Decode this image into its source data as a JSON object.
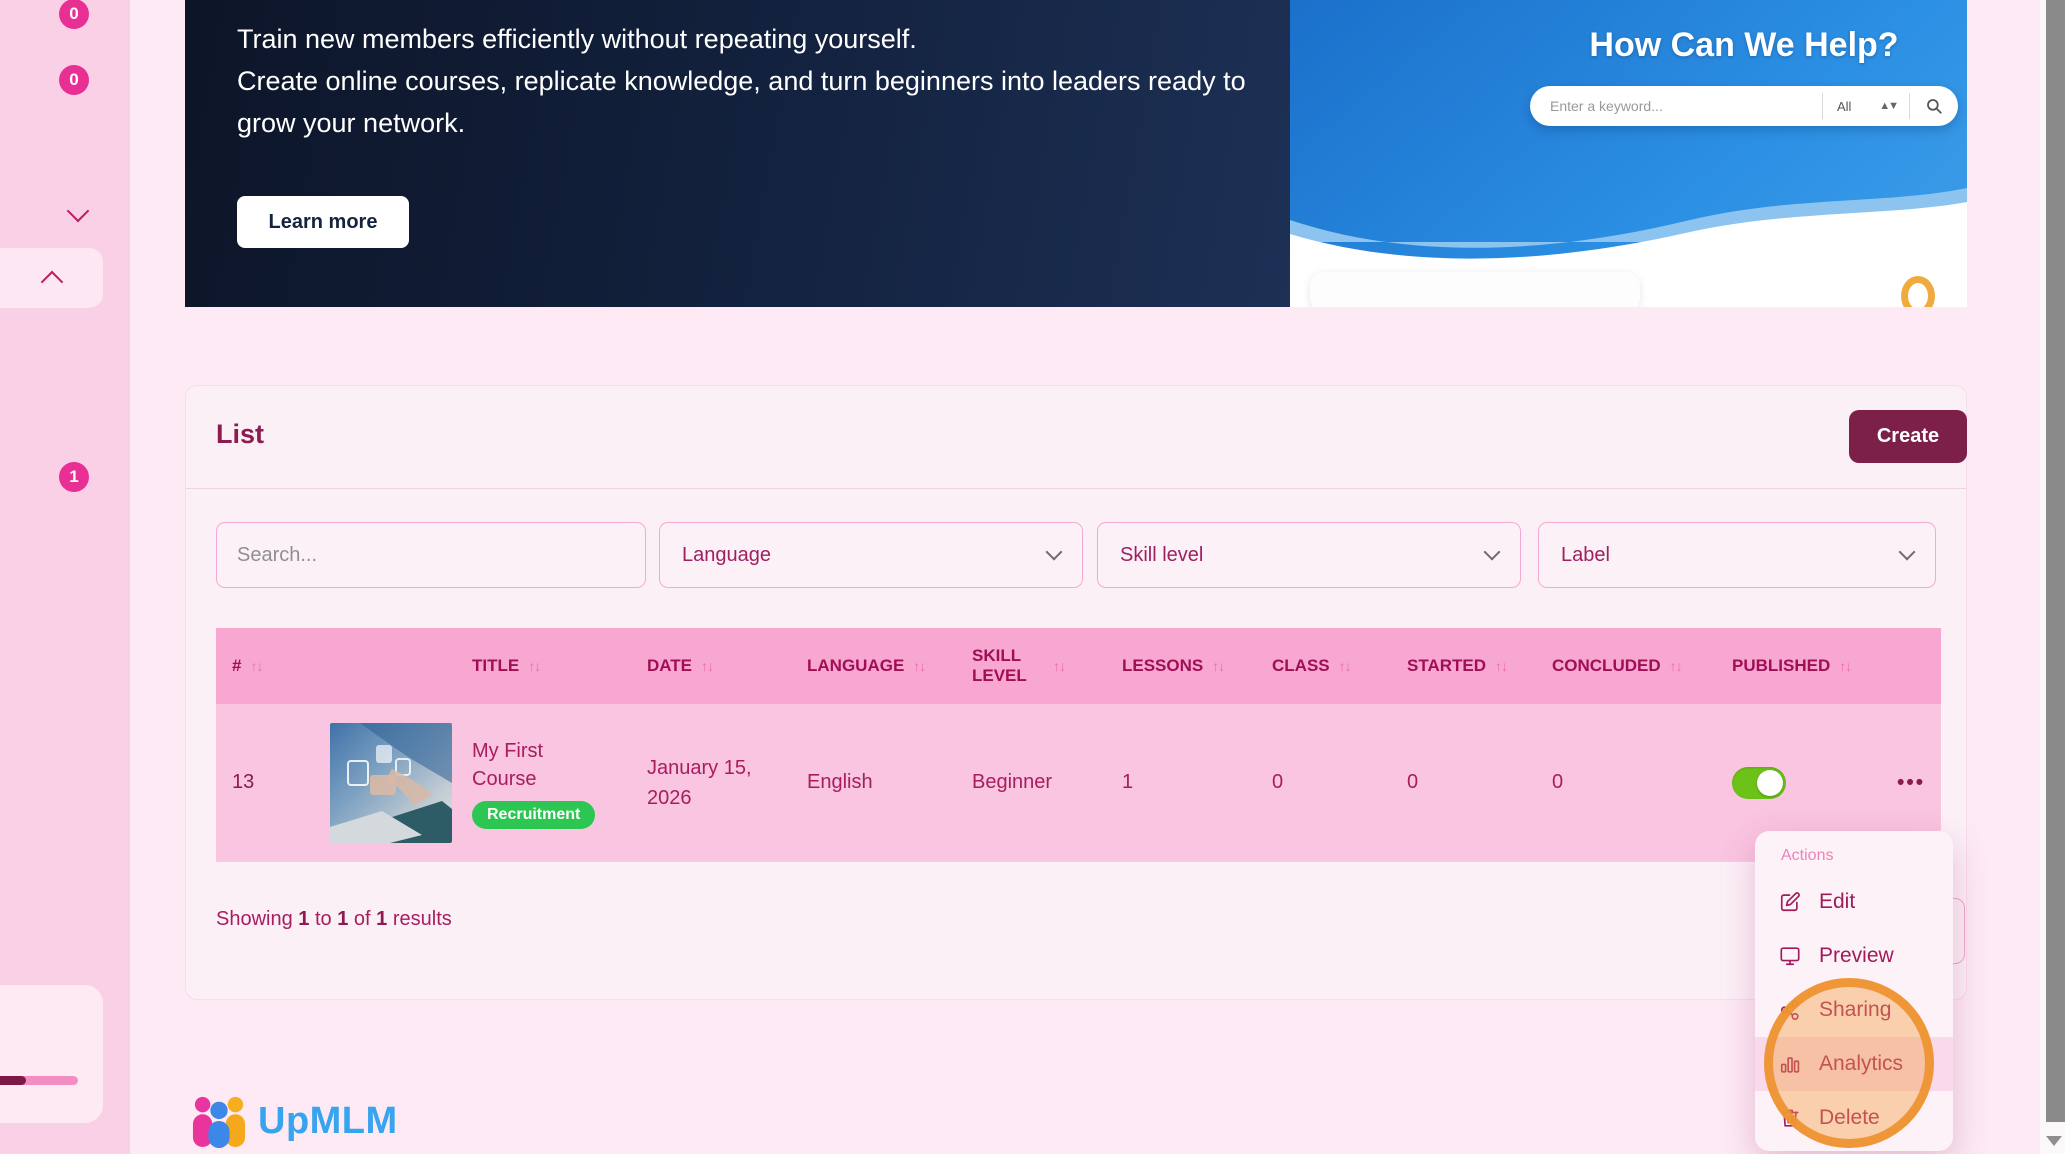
{
  "sidebar": {
    "badge_top": "0",
    "badge_second": "0",
    "badge_lower": "1"
  },
  "hero": {
    "line1": "Train new members efficiently without repeating yourself.",
    "line2": "Create online courses, replicate knowledge, and turn beginners into leaders ready to grow your network.",
    "learn_more_label": "Learn more",
    "help_panel": {
      "title": "How Can We Help?",
      "search_placeholder": "Enter a keyword...",
      "category_value": "All",
      "updown_icon": "▲▼",
      "search_icon": "magnifier"
    }
  },
  "list_card": {
    "title": "List",
    "create_label": "Create",
    "filters": {
      "search_placeholder": "Search...",
      "language_label": "Language",
      "skill_level_label": "Skill level",
      "label_label": "Label"
    },
    "table": {
      "sort_icon": "↑↓",
      "columns": [
        "#",
        "TITLE",
        "DATE",
        "LANGUAGE",
        "SKILL LEVEL",
        "LESSONS",
        "CLASS",
        "STARTED",
        "CONCLUDED",
        "PUBLISHED"
      ],
      "row": {
        "id": "13",
        "title": "My First Course",
        "label_badge": "Recruitment",
        "date": "January 15, 2026",
        "language": "English",
        "skill_level": "Beginner",
        "lessons": "1",
        "class": "0",
        "started": "0",
        "concluded": "0",
        "published": "on",
        "menu_icon": "•••"
      }
    },
    "results": {
      "prefix": "Showing",
      "from": "1",
      "mid1": "to",
      "to": "1",
      "mid2": "of",
      "total": "1",
      "suffix": "results"
    }
  },
  "action_menu": {
    "label": "Actions",
    "items": [
      {
        "label": "Edit",
        "icon": "edit-icon"
      },
      {
        "label": "Preview",
        "icon": "monitor-icon"
      },
      {
        "label": "Sharing",
        "icon": "share-icon"
      },
      {
        "label": "Analytics",
        "icon": "bar-chart-icon"
      },
      {
        "label": "Delete",
        "icon": "trash-icon"
      }
    ]
  },
  "footer": {
    "brand": "UpMLM"
  },
  "colors": {
    "accent_maroon": "#7d2049",
    "table_header_pink": "#f8a7d0",
    "row_pink": "#f9c5e0",
    "badge_green": "#2dc653",
    "toggle_green": "#6cc218",
    "annotation_orange": "#ee9432",
    "brand_blue": "#38a3ee",
    "sidebar_badge_pink": "#e72f94"
  }
}
